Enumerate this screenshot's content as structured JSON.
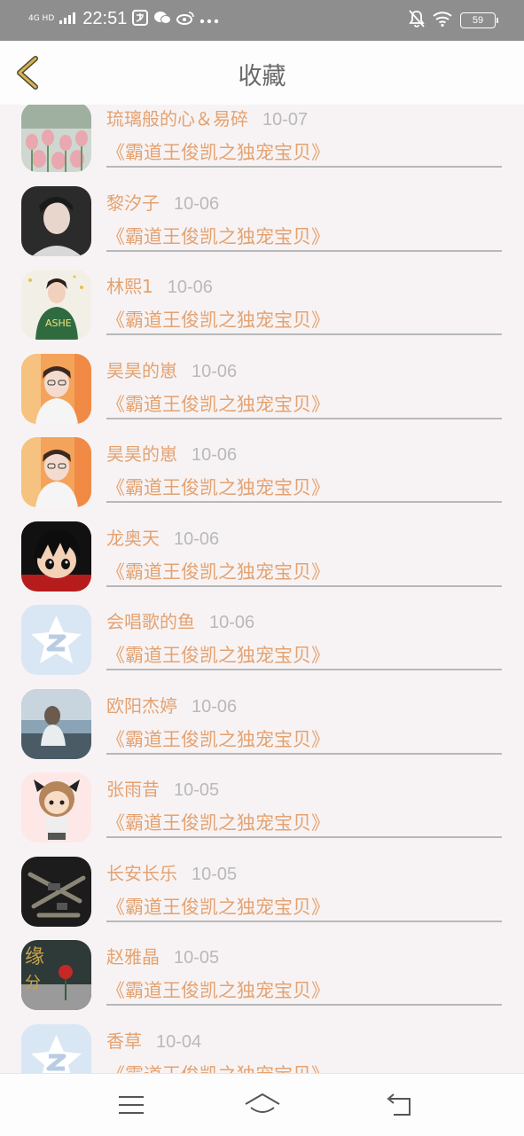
{
  "status_bar": {
    "network": "4G HD",
    "time": "22:51",
    "battery": "59"
  },
  "header": {
    "title": "收藏"
  },
  "favorites": [
    {
      "name": "琉璃般的心＆易碎",
      "date": "10-07",
      "work": "《霸道王俊凯之独宠宝贝》",
      "avatar": "tulips"
    },
    {
      "name": "黎汐子",
      "date": "10-06",
      "work": "《霸道王俊凯之独宠宝贝》",
      "avatar": "dark-boy"
    },
    {
      "name": "林熙1",
      "date": "10-06",
      "work": "《霸道王俊凯之独宠宝贝》",
      "avatar": "green-girl"
    },
    {
      "name": "昊昊的崽",
      "date": "10-06",
      "work": "《霸道王俊凯之独宠宝贝》",
      "avatar": "orange-boy"
    },
    {
      "name": "昊昊的崽",
      "date": "10-06",
      "work": "《霸道王俊凯之独宠宝贝》",
      "avatar": "orange-boy"
    },
    {
      "name": "龙奥天",
      "date": "10-06",
      "work": "《霸道王俊凯之独宠宝贝》",
      "avatar": "cartoon"
    },
    {
      "name": "会唱歌的鱼",
      "date": "10-06",
      "work": "《霸道王俊凯之独宠宝贝》",
      "avatar": "default-qzone"
    },
    {
      "name": "欧阳杰婷",
      "date": "10-06",
      "work": "《霸道王俊凯之独宠宝贝》",
      "avatar": "girl-water"
    },
    {
      "name": "张雨昔",
      "date": "10-05",
      "work": "《霸道王俊凯之独宠宝贝》",
      "avatar": "chibi"
    },
    {
      "name": "长安长乐",
      "date": "10-05",
      "work": "《霸道王俊凯之独宠宝贝》",
      "avatar": "guns"
    },
    {
      "name": "赵雅晶",
      "date": "10-05",
      "work": "《霸道王俊凯之独宠宝贝》",
      "avatar": "rose"
    },
    {
      "name": "香草",
      "date": "10-04",
      "work": "《霸道王俊凯之独宠宝贝》",
      "avatar": "default-qzone"
    }
  ],
  "colors": {
    "accent": "#e4a270",
    "date": "#b9b9b9",
    "status_bar": "#8e8e8e",
    "back_icon": "#d9b44a"
  },
  "nav": {
    "icons": [
      "menu-icon",
      "home-icon",
      "back-arrow-icon"
    ]
  }
}
